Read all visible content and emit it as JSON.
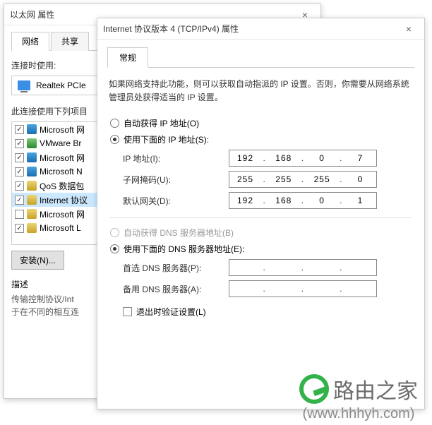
{
  "ether": {
    "title": "以太网 属性",
    "tabs": {
      "network": "网络",
      "share": "共享"
    },
    "connectUsing": "连接时使用:",
    "adapter": "Realtek PCIe",
    "itemsLabel": "此连接使用下列项目",
    "items": [
      {
        "label": "Microsoft 网",
        "checked": true,
        "icon": "net"
      },
      {
        "label": "VMware Br",
        "checked": true,
        "icon": "drv"
      },
      {
        "label": "Microsoft 网",
        "checked": true,
        "icon": "net"
      },
      {
        "label": "Microsoft N",
        "checked": true,
        "icon": "net"
      },
      {
        "label": "QoS 数据包",
        "checked": true,
        "icon": "svc"
      },
      {
        "label": "Internet 协议",
        "checked": true,
        "icon": "svc",
        "selected": true
      },
      {
        "label": "Microsoft 网",
        "checked": false,
        "icon": "svc"
      },
      {
        "label": "Microsoft L",
        "checked": true,
        "icon": "svc"
      }
    ],
    "install": "安装(N)...",
    "descLabel": "描述",
    "desc1": "传输控制协议/Int",
    "desc2": "于在不同的相互连"
  },
  "ip": {
    "title": "Internet 协议版本 4 (TCP/IPv4) 属性",
    "tab": "常规",
    "intro": "如果网络支持此功能，则可以获取自动指派的 IP 设置。否则，你需要从网络系统管理员处获得适当的 IP 设置。",
    "radioAutoIp": "自动获得 IP 地址(O)",
    "radioManualIp": "使用下面的 IP 地址(S):",
    "lblIp": "IP 地址(I):",
    "lblMask": "子网掩码(U):",
    "lblGw": "默认网关(D):",
    "valIp": [
      "192",
      "168",
      "0",
      "7"
    ],
    "valMask": [
      "255",
      "255",
      "255",
      "0"
    ],
    "valGw": [
      "192",
      "168",
      "0",
      "1"
    ],
    "radioAutoDns": "自动获得 DNS 服务器地址(B)",
    "radioManualDns": "使用下面的 DNS 服务器地址(E):",
    "lblDns1": "首选 DNS 服务器(P):",
    "lblDns2": "备用 DNS 服务器(A):",
    "valDns1": [
      "",
      "",
      "",
      ""
    ],
    "valDns2": [
      "",
      "",
      "",
      ""
    ],
    "exitValidate": "退出时验证设置(L)"
  },
  "watermark": {
    "name": "路由之家",
    "url": "(www.hhhyh.com)"
  }
}
